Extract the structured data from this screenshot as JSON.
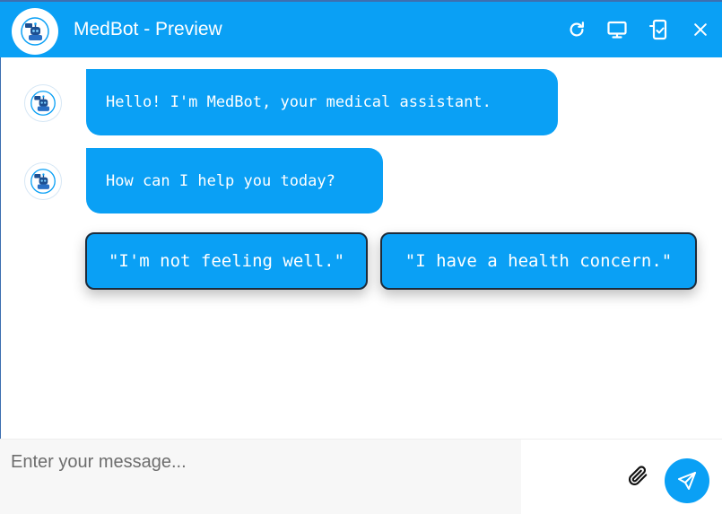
{
  "header": {
    "title": "MedBot - Preview",
    "icons": [
      "robot-avatar-icon",
      "refresh-icon",
      "desktop-icon",
      "mobile-icon",
      "close-icon"
    ]
  },
  "messages": [
    {
      "sender": "bot",
      "text": "Hello! I'm MedBot, your medical assistant."
    },
    {
      "sender": "bot",
      "text": "How can I help you today?"
    }
  ],
  "quick_replies": [
    {
      "label": "\"I'm not feeling well.\""
    },
    {
      "label": "\"I have a health concern.\""
    }
  ],
  "composer": {
    "placeholder": "Enter your message...",
    "value": "",
    "icons": [
      "paperclip-icon",
      "send-icon"
    ]
  },
  "colors": {
    "primary": "#0aa0f5",
    "header_text": "#ffffff",
    "reply_border": "#1d2b3a",
    "input_background": "#f7f7f7"
  }
}
